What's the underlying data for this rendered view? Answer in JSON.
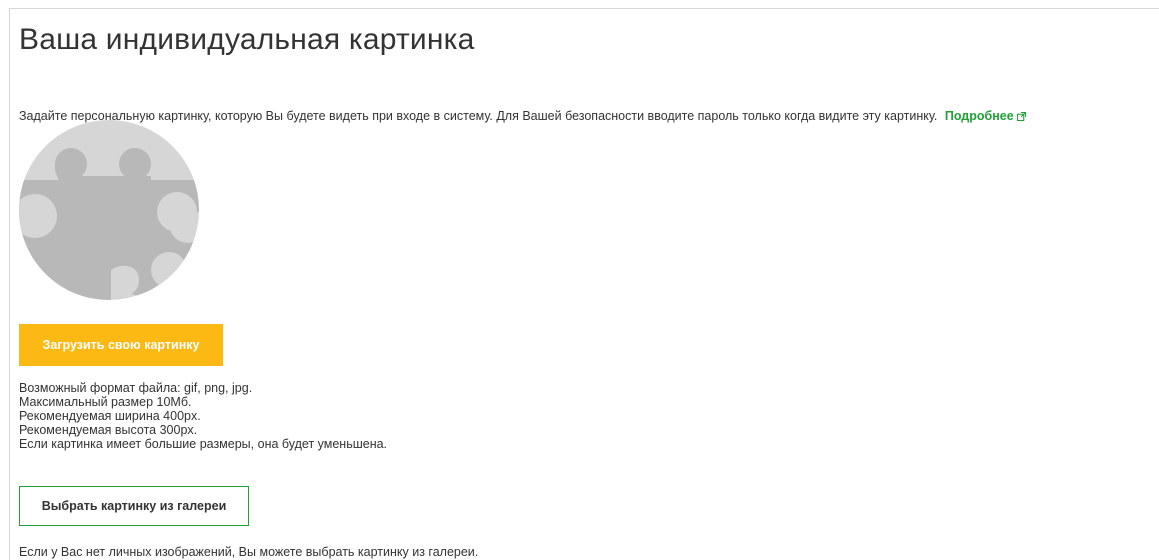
{
  "page": {
    "title": "Ваша индивидуальная картинка",
    "intro_text": "Задайте персональную картинку, которую Вы будете видеть при входе в систему. Для Вашей безопасности вводите пароль только когда видите эту картинку.",
    "more_link_label": "Подробнее",
    "more_link_icon": "external-link-icon"
  },
  "avatar": {
    "icon": "puzzle-placeholder-icon",
    "colors": {
      "background": "#d6d6d6",
      "shape": "#b8b8b8"
    }
  },
  "upload": {
    "button_label": "Загрузить свою картинку",
    "color": "#fcb813"
  },
  "hints": [
    "Возможный формат файла: gif, png, jpg.",
    "Максимальный размер 10Мб.",
    "Рекомендуемая ширина 400px.",
    "Рекомендуемая высота 300px.",
    "Если картинка имеет большие размеры, она будет уменьшена."
  ],
  "gallery": {
    "button_label": "Выбрать картинку из галереи",
    "note": "Если у Вас нет личных изображений, Вы можете выбрать картинку из галереи."
  },
  "colors": {
    "accent_green": "#21a038",
    "text": "#333333",
    "border": "#d6d6d6"
  }
}
